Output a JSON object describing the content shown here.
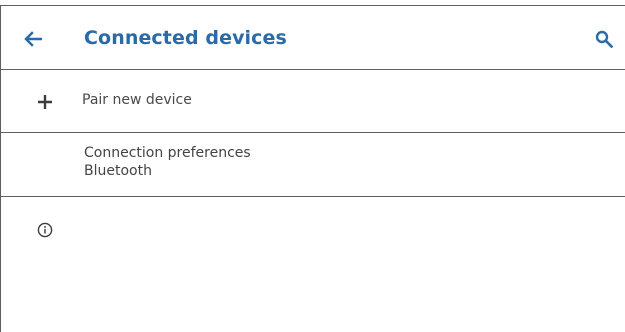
{
  "header": {
    "title": "Connected devices",
    "back_icon": "arrow-back-icon",
    "search_icon": "search-icon",
    "accent_color": "#2a6aa7"
  },
  "list": {
    "pair_new_device": {
      "label": "Pair new device",
      "icon": "plus-icon"
    },
    "connection_preferences": {
      "title": "Connection preferences",
      "summary": "Bluetooth"
    }
  },
  "footer": {
    "info_icon": "info-icon"
  }
}
